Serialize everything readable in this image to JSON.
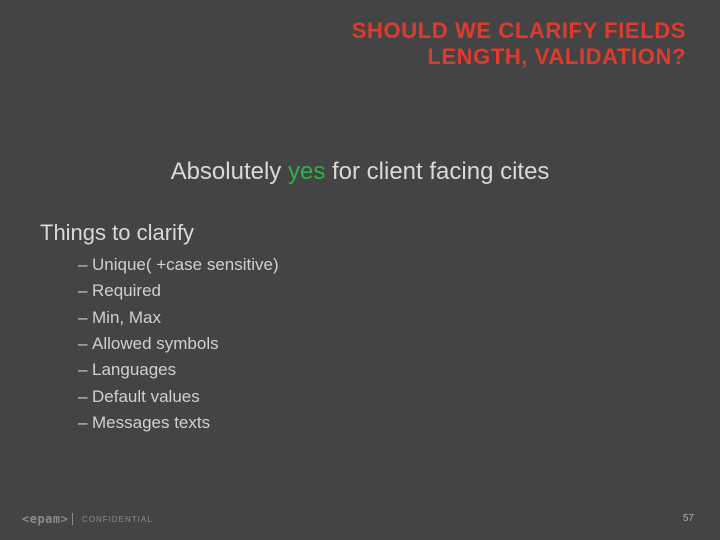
{
  "title": {
    "line1": "SHOULD WE CLARIFY FIELDS",
    "line2": "LENGTH, VALIDATION?"
  },
  "headline": {
    "before": "Absolutely ",
    "accent": "yes",
    "after": " for client facing cites"
  },
  "section_label": "Things to clarify",
  "bullets": [
    "Unique( +case sensitive)",
    "Required",
    "Min, Max",
    "Allowed symbols",
    "Languages",
    "Default values",
    "Messages texts"
  ],
  "footer": {
    "logo": "<epam>",
    "confidential": "CONFIDENTIAL",
    "page": "57"
  },
  "colors": {
    "background": "#444444",
    "title": "#e03a2e",
    "accent": "#2db24a",
    "body": "#d9d9d9",
    "footer": "#8c8c8c"
  }
}
